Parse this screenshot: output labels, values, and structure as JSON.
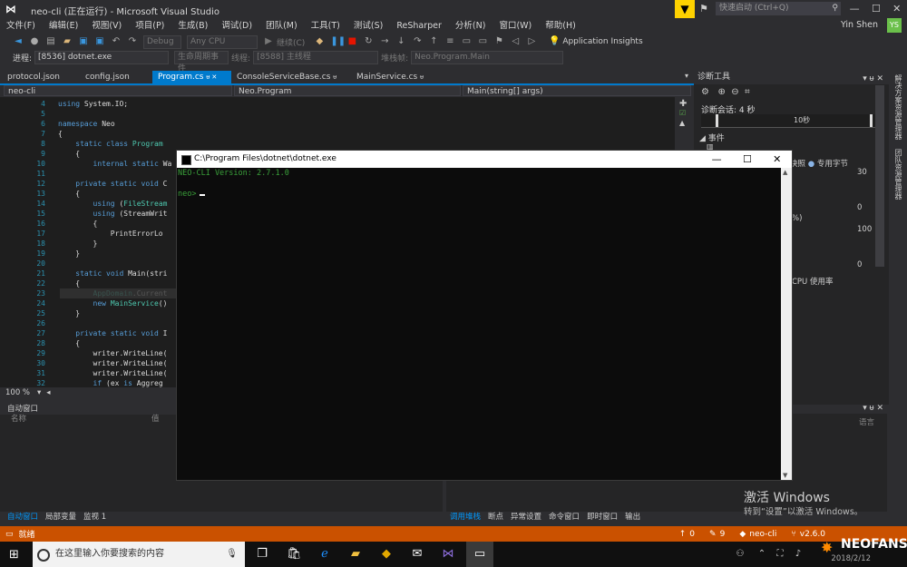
{
  "titlebar": {
    "title": "neo-cli (正在运行) - Microsoft Visual Studio",
    "quick_launch_placeholder": "快速启动 (Ctrl+Q)"
  },
  "menu": {
    "items": [
      "文件(F)",
      "编辑(E)",
      "视图(V)",
      "项目(P)",
      "生成(B)",
      "调试(D)",
      "团队(M)",
      "工具(T)",
      "测试(S)",
      "ReSharper",
      "分析(N)",
      "窗口(W)",
      "帮助(H)"
    ],
    "user": "Yin Shen",
    "avatar": "YS"
  },
  "toolbar": {
    "config": "Debug",
    "platform": "Any CPU",
    "continue": "继续(C)",
    "app_insights": "Application Insights"
  },
  "toolbar2": {
    "process_label": "进程:",
    "process": "[8536] dotnet.exe",
    "lifecycle": "生命周期事件",
    "thread_label": "线程:",
    "thread": "[8588] 主线程",
    "stack_label": "堆栈帧:",
    "stack": "Neo.Program.Main"
  },
  "tabs": [
    {
      "label": "protocol.json"
    },
    {
      "label": "config.json"
    },
    {
      "label": "Program.cs"
    },
    {
      "label": "ConsoleServiceBase.cs"
    },
    {
      "label": "MainService.cs"
    }
  ],
  "nav": {
    "project": "neo-cli",
    "class": "Neo.Program",
    "member": "Main(string[] args)"
  },
  "code": [
    {
      "n": "4",
      "t": "using System.IO;"
    },
    {
      "n": "5",
      "t": ""
    },
    {
      "n": "6",
      "t": "namespace Neo"
    },
    {
      "n": "7",
      "t": "{"
    },
    {
      "n": "8",
      "t": "    static class Program"
    },
    {
      "n": "9",
      "t": "    {"
    },
    {
      "n": "10",
      "t": "        internal static Wa"
    },
    {
      "n": "11",
      "t": ""
    },
    {
      "n": "12",
      "t": "    private static void C"
    },
    {
      "n": "13",
      "t": "    {"
    },
    {
      "n": "14",
      "t": "        using (FileStream"
    },
    {
      "n": "15",
      "t": "        using (StreamWrit"
    },
    {
      "n": "16",
      "t": "        {"
    },
    {
      "n": "17",
      "t": "            PrintErrorLo"
    },
    {
      "n": "18",
      "t": "        }"
    },
    {
      "n": "19",
      "t": "    }"
    },
    {
      "n": "20",
      "t": ""
    },
    {
      "n": "21",
      "t": "    static void Main(stri"
    },
    {
      "n": "22",
      "t": "    {"
    },
    {
      "n": "23",
      "t": "        AppDomain.Current"
    },
    {
      "n": "24",
      "t": "        new MainService()"
    },
    {
      "n": "25",
      "t": "    }"
    },
    {
      "n": "26",
      "t": ""
    },
    {
      "n": "27",
      "t": "    private static void I"
    },
    {
      "n": "28",
      "t": "    {"
    },
    {
      "n": "29",
      "t": "        writer.WriteLine("
    },
    {
      "n": "30",
      "t": "        writer.WriteLine("
    },
    {
      "n": "31",
      "t": "        writer.WriteLine("
    },
    {
      "n": "32",
      "t": "        if (ex is Aggreg"
    }
  ],
  "zoom": "100 %",
  "autos": {
    "title": "自动窗口",
    "col_name": "名称",
    "col_value": "值",
    "col_lang": "语言"
  },
  "bottom_tabs_left": [
    "自动窗口",
    "局部变量",
    "监视 1"
  ],
  "bottom_tabs_right": [
    "调用堆栈",
    "断点",
    "异常设置",
    "命令窗口",
    "即时窗口",
    "输出"
  ],
  "diag": {
    "title": "诊断工具",
    "session": "诊断会话: 4 秒",
    "tick": "10秒",
    "events": "事件",
    "snapshot": "快照",
    "private_bytes": "专用字节",
    "v30": "30",
    "v0a": "0",
    "v100": "100",
    "v0b": "0",
    "cpu": "CPU 使用率",
    "pct": "%)"
  },
  "vtabs": [
    "解决方案资源管理器",
    "团队资源管理器"
  ],
  "status": {
    "ready": "就绪",
    "up": "0",
    "pencil": "9",
    "repo": "neo-cli",
    "branch": "v2.6.0"
  },
  "activate": {
    "line1": "激活 Windows",
    "line2": "转到“设置”以激活 Windows。"
  },
  "watermark": "NEOFANS",
  "taskbar": {
    "search_placeholder": "在这里输入你要搜索的内容",
    "date": "2018/2/12"
  },
  "console": {
    "title": "C:\\Program Files\\dotnet\\dotnet.exe",
    "line1": "NEO-CLI Version: 2.7.1.0",
    "prompt": "neo>"
  }
}
